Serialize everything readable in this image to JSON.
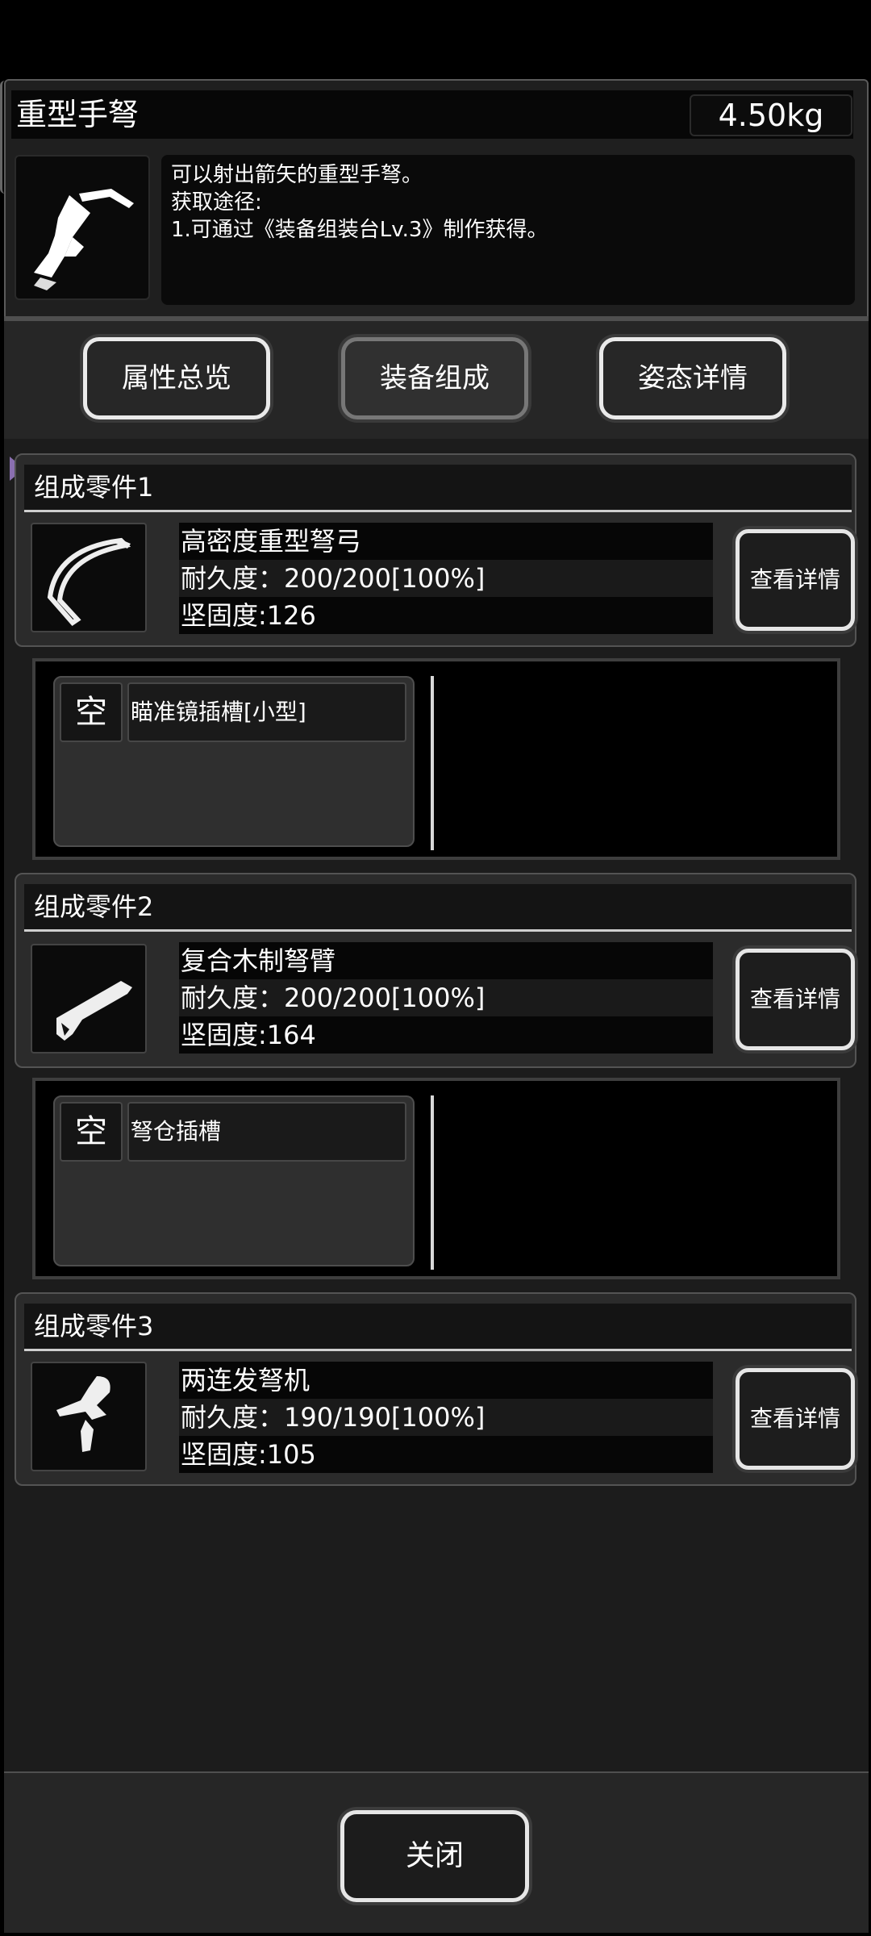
{
  "header": {
    "title": "重型手弩",
    "weight": "4.50kg"
  },
  "description": {
    "lines": [
      "可以射出箭矢的重型手弩。",
      "获取途径:",
      "1.可通过《装备组装台Lv.3》制作获得。"
    ]
  },
  "tabs": [
    {
      "label": "属性总览"
    },
    {
      "label": "装备组成",
      "active": true
    },
    {
      "label": "姿态详情"
    }
  ],
  "parts": [
    {
      "title": "组成零件1",
      "name": "高密度重型弩弓",
      "durability": "耐久度：200/200[100%]",
      "hardness": "坚固度:126",
      "detail_label": "查看详情",
      "icon": "crossbow-bow-icon",
      "slot": {
        "empty_label": "空",
        "name": "瞄准镜插槽[小型]"
      }
    },
    {
      "title": "组成零件2",
      "name": "复合木制弩臂",
      "durability": "耐久度：200/200[100%]",
      "hardness": "坚固度:164",
      "detail_label": "查看详情",
      "icon": "crossbow-stock-icon",
      "slot": {
        "empty_label": "空",
        "name": "弩仓插槽"
      }
    },
    {
      "title": "组成零件3",
      "name": "两连发弩机",
      "durability": "耐久度：190/190[100%]",
      "hardness": "坚固度:105",
      "detail_label": "查看详情",
      "icon": "trigger-mechanism-icon"
    }
  ],
  "footer": {
    "close_label": "关闭"
  },
  "colors": {
    "background": "#000000",
    "panel": "#1f1f1f",
    "text": "#ffffff",
    "indicator": "#ff2020"
  }
}
